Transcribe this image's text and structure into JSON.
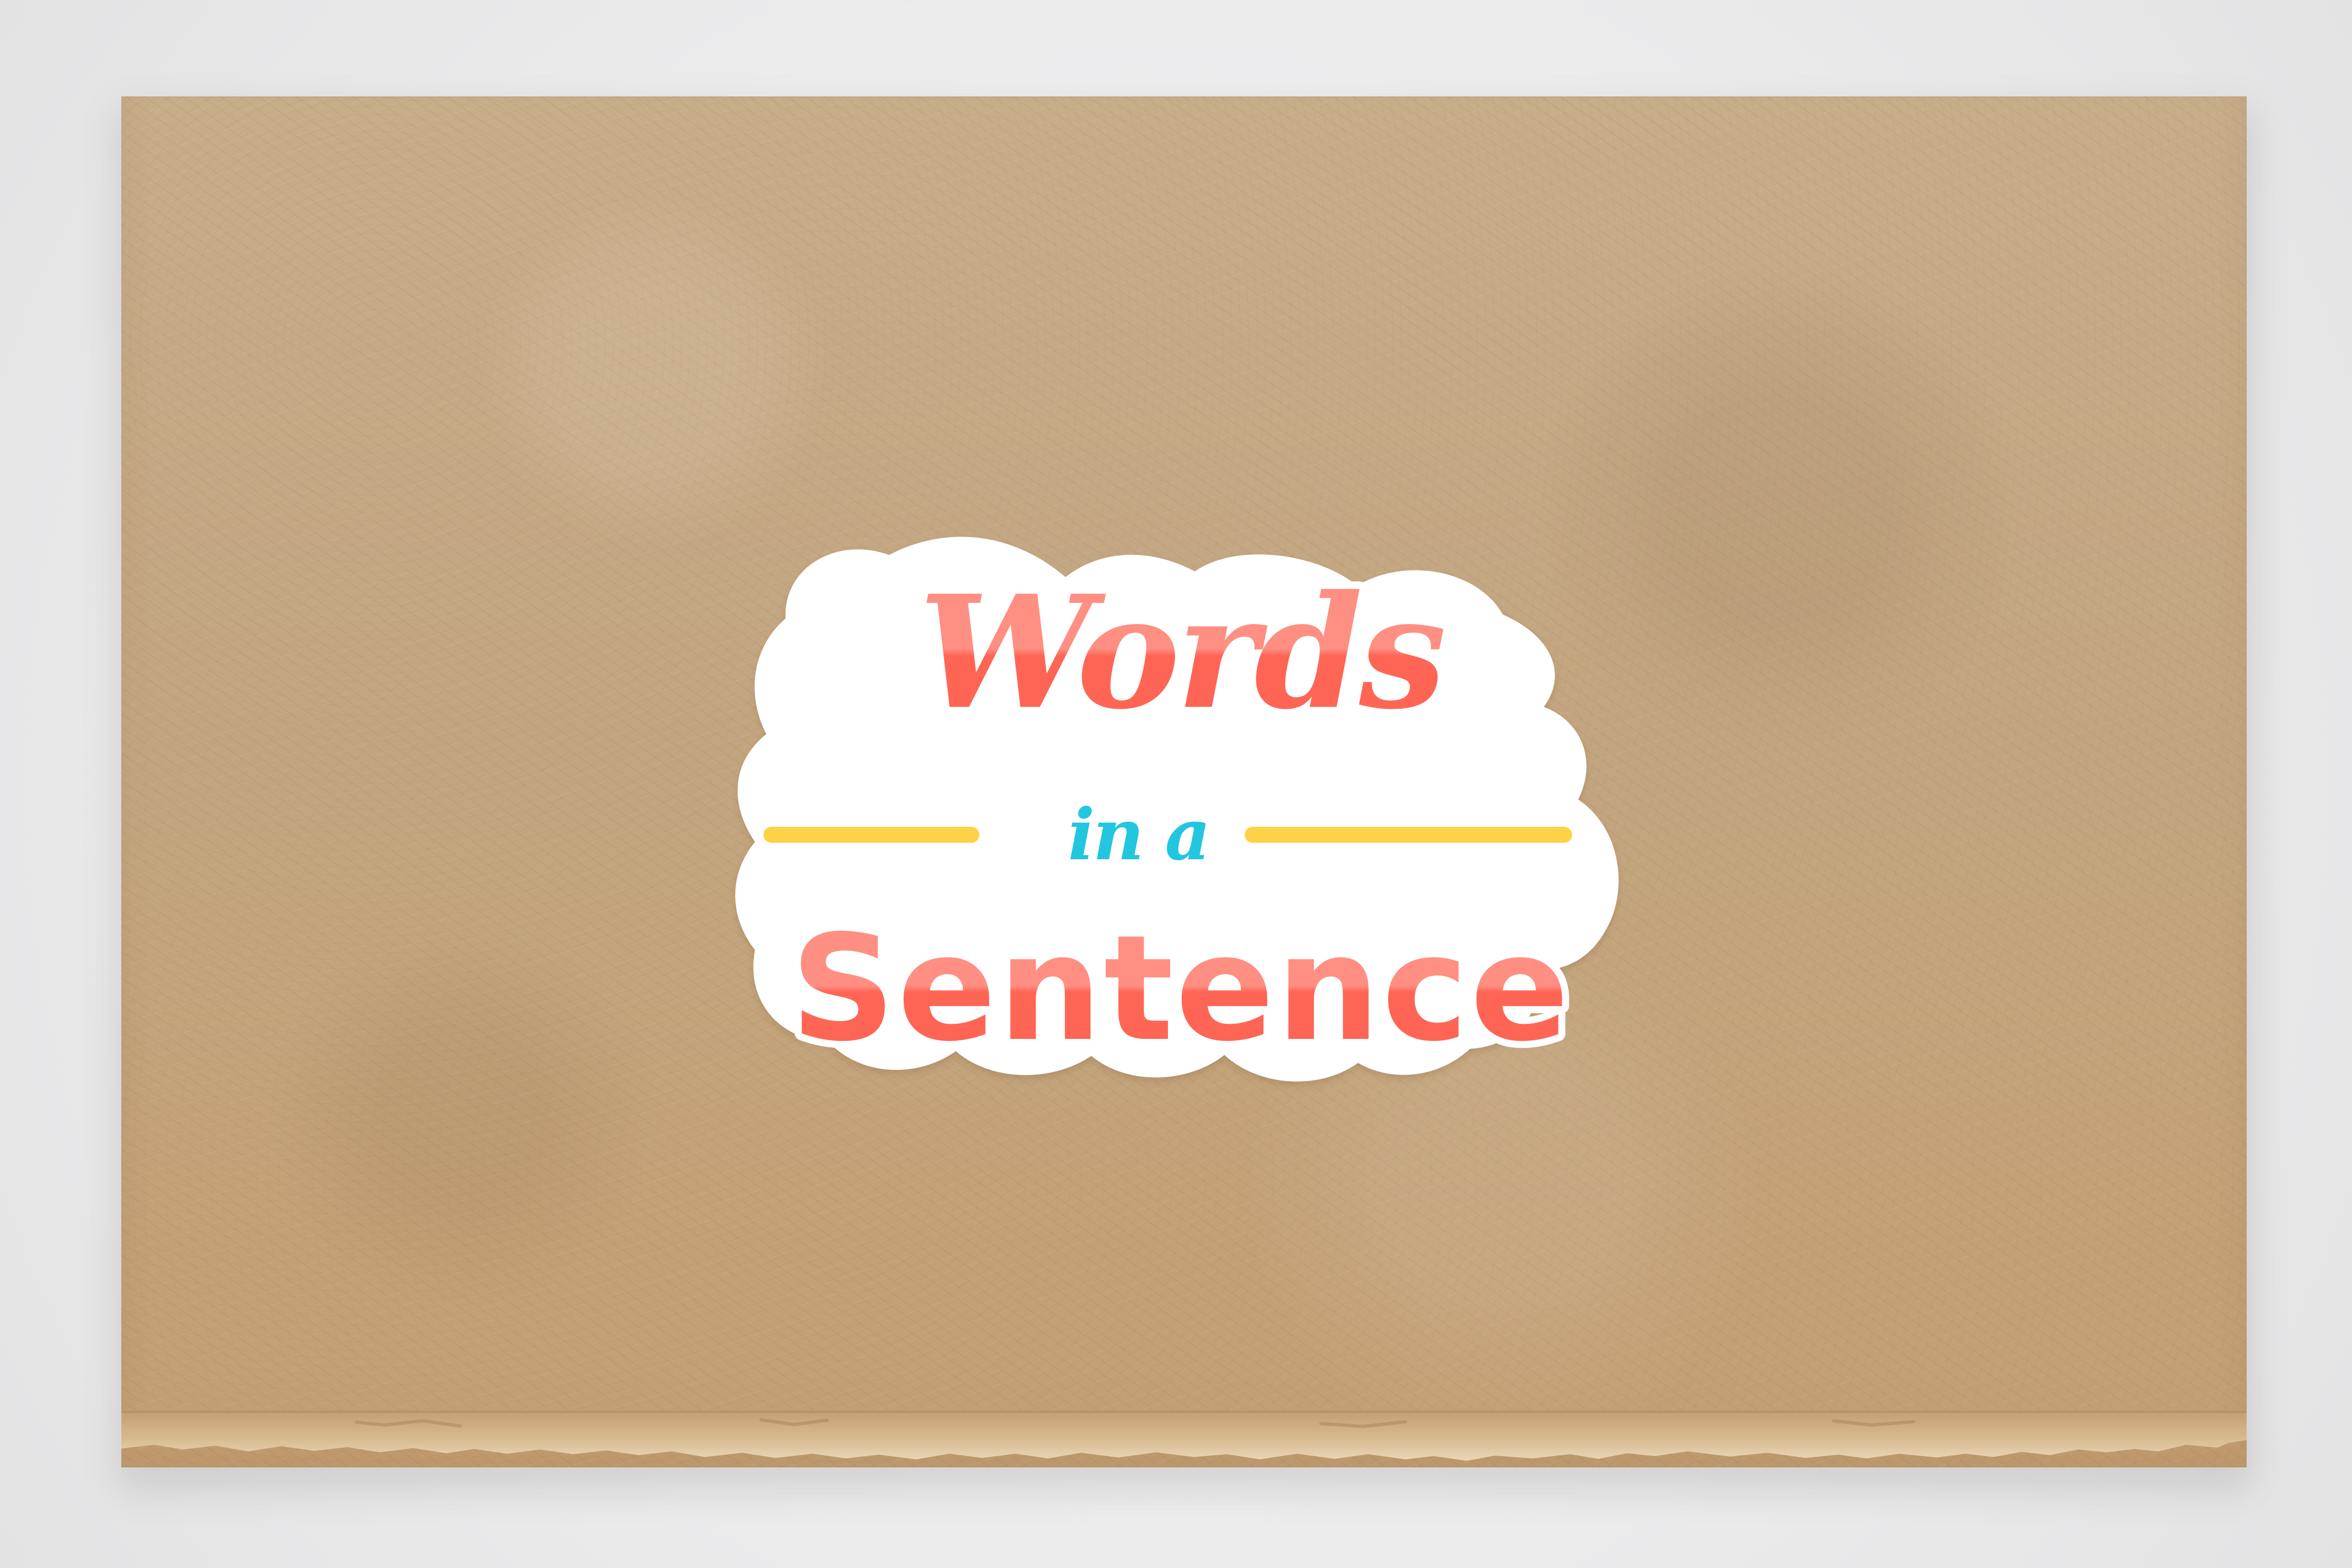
{
  "scene": {
    "background_color": "#ededee",
    "paper_color": "#c5a77f",
    "sticker_background": "#ffffff"
  },
  "sticker": {
    "line_1": "Words",
    "line_2": "in a",
    "line_3": "Sentence",
    "colors": {
      "main_text": "#ff685a",
      "main_text_highlight": "#ff8f82",
      "small_text": "#22c6df",
      "accent_line": "#ffd146"
    }
  }
}
